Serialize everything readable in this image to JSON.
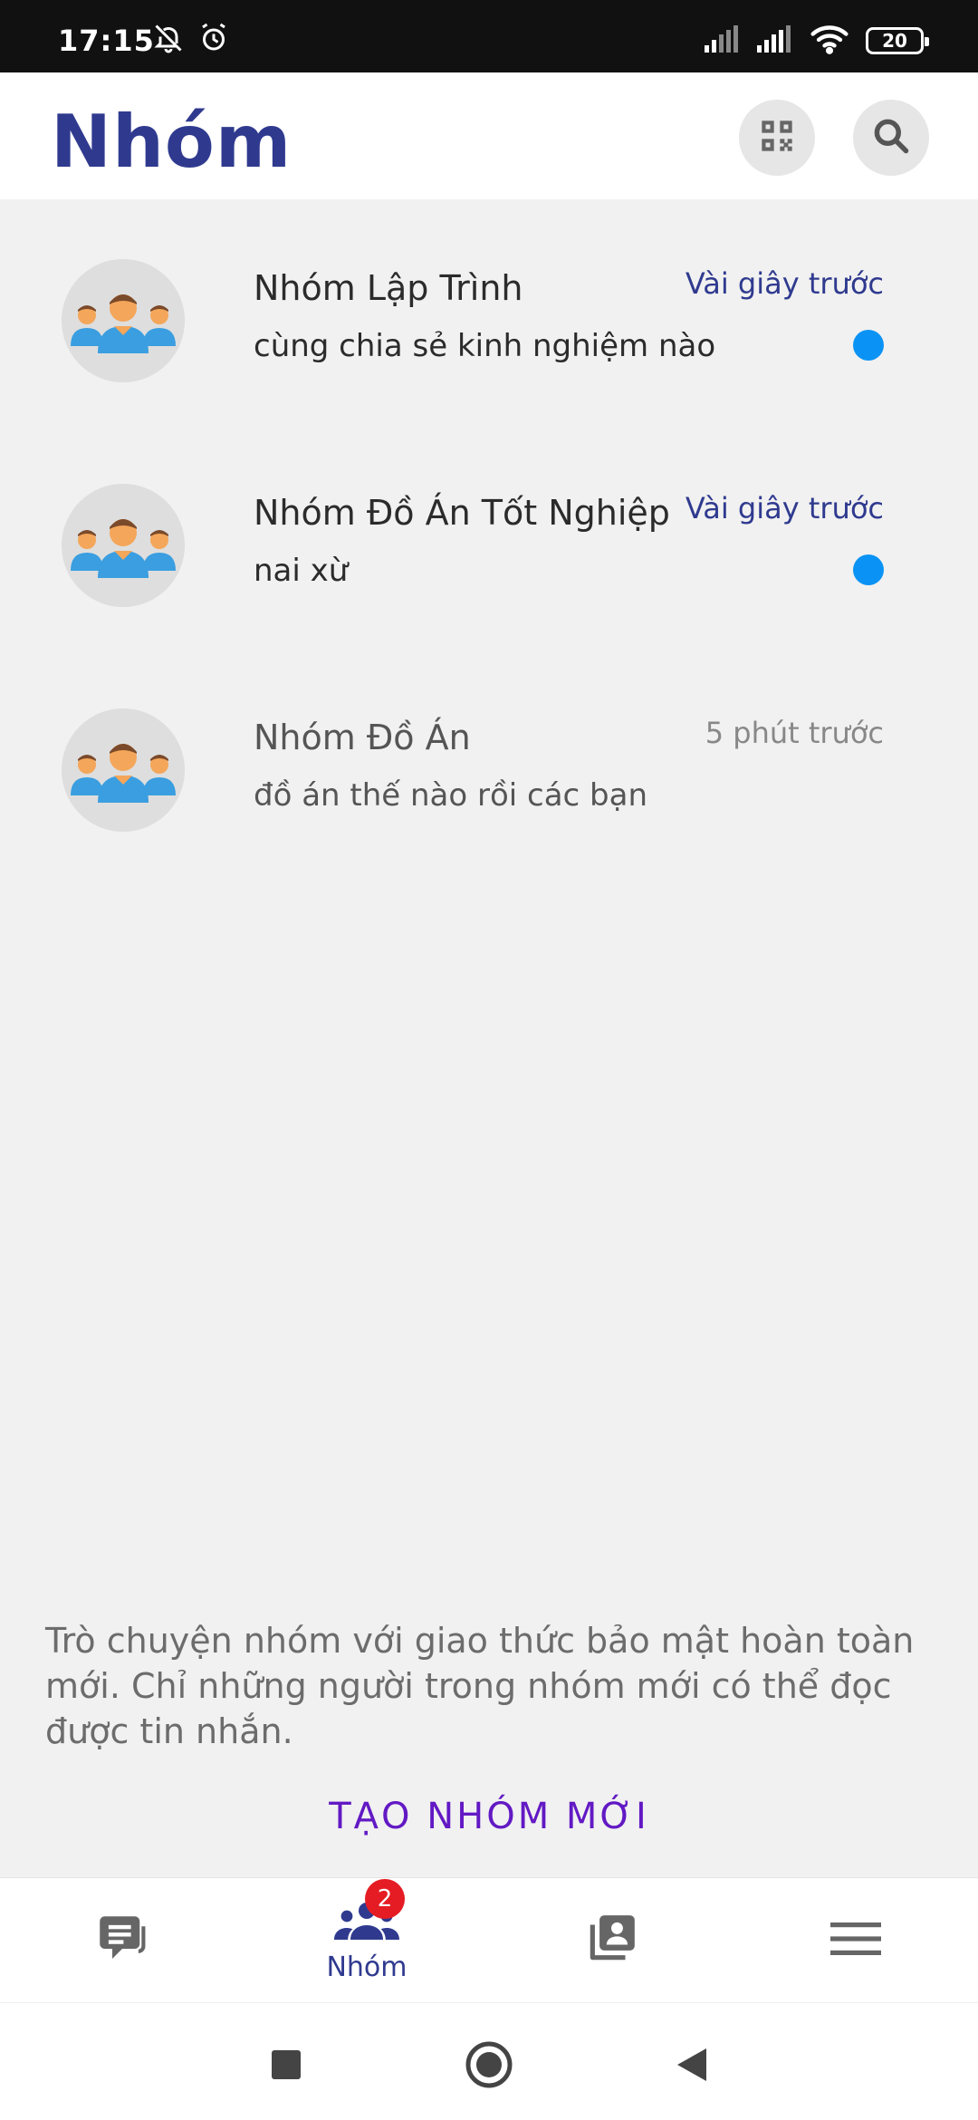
{
  "status_bar": {
    "time": "17:15",
    "battery": "20",
    "icons": [
      "bell-off-icon",
      "alarm-icon",
      "signal-icon",
      "signal-icon",
      "wifi-icon",
      "battery-icon"
    ]
  },
  "header": {
    "title": "Nhóm",
    "icons": [
      "qr-code-icon",
      "search-icon"
    ]
  },
  "groups": [
    {
      "name": "Nhóm Lập Trình",
      "time": "Vài giây trước",
      "message": "cùng chia sẻ kinh nghiệm nào",
      "unread": true
    },
    {
      "name": "Nhóm Đồ Án Tốt Nghiệp",
      "time": "Vài giây trước",
      "message": "nai xừ",
      "unread": true
    },
    {
      "name": "Nhóm Đồ Án",
      "time": "5 phút trước",
      "message": "đồ án thế nào rồi các bạn",
      "unread": false
    }
  ],
  "info": {
    "text": "Trò chuyện nhóm với giao thức bảo mật hoàn toàn mới. Chỉ những người trong nhóm mới có thể đọc được tin nhắn.",
    "create_button": "TẠO NHÓM MỚI"
  },
  "bottom_nav": {
    "items": [
      {
        "icon": "chat-icon",
        "label": ""
      },
      {
        "icon": "group-icon",
        "label": "Nhóm",
        "badge": "2",
        "active": true
      },
      {
        "icon": "contacts-icon",
        "label": ""
      },
      {
        "icon": "menu-icon",
        "label": ""
      }
    ]
  },
  "colors": {
    "accent": "#2f3a8f",
    "unread_dot": "#0a93f5",
    "create_button": "#6219c4",
    "badge": "#e51c23",
    "background": "#f1f1f1"
  }
}
